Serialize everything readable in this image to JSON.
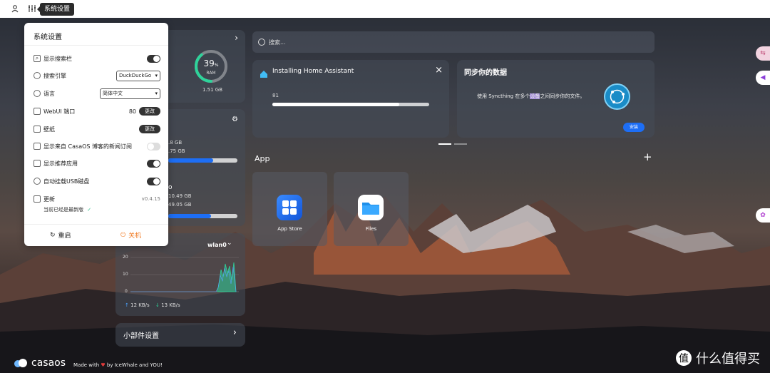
{
  "topbar": {
    "tooltip": "系统设置"
  },
  "settings": {
    "title": "系统设置",
    "rows": [
      {
        "label": "显示搜索栏"
      },
      {
        "label": "搜索引擎",
        "value": "DuckDuckGo"
      },
      {
        "label": "语言",
        "value": "简体中文"
      },
      {
        "label": "WebUI 端口",
        "value": "80",
        "button": "更改"
      },
      {
        "label": "壁纸",
        "button": "更改"
      },
      {
        "label": "显示来自 CasaOS 博客的新闻订阅"
      },
      {
        "label": "显示推荐应用"
      },
      {
        "label": "自动挂载USB磁盘"
      },
      {
        "label": "更新",
        "version": "v0.4.15",
        "status": "当前已经是最新版"
      }
    ],
    "restart": "重启",
    "shutdown": "关机"
  },
  "system": {
    "ram_percent": "39",
    "ram_percent_value": 39,
    "ram_unit": "%",
    "ram_label": "RAM",
    "ram_used": "1.51 GB"
  },
  "storage": {
    "first": {
      "line1": ".8 GB",
      "line2": ".75 GB",
      "fill": 0.65
    },
    "second": {
      "letter": "o",
      "line1": "10.49 GB",
      "line2": "49.05 GB",
      "fill": 0.62
    }
  },
  "network": {
    "interface": "wlan0",
    "y_ticks": [
      "20",
      "10",
      "0"
    ],
    "upload": "12 KB/s",
    "download": "13 KB/s"
  },
  "widget_settings": "小部件设置",
  "search": {
    "placeholder": "搜索..."
  },
  "install": {
    "title": "Installing Home Assistant",
    "progress": "81",
    "progress_value": 81
  },
  "sync": {
    "title": "同步你的数据",
    "text_before": "使用 Syncthing 在多个",
    "text_highlight": "设备",
    "text_after": "之间同步你的文件。",
    "button": "安装"
  },
  "apps": {
    "heading": "App",
    "items": [
      {
        "name": "App Store"
      },
      {
        "name": "Files"
      }
    ]
  },
  "footer": {
    "brand": "casaos",
    "made_prefix": "Made with",
    "made_suffix": "by IceWhale and YOU!",
    "watermark": "什么值得买"
  },
  "colors": {
    "accent": "#1d6ef5",
    "ring": "#2ed39a"
  }
}
